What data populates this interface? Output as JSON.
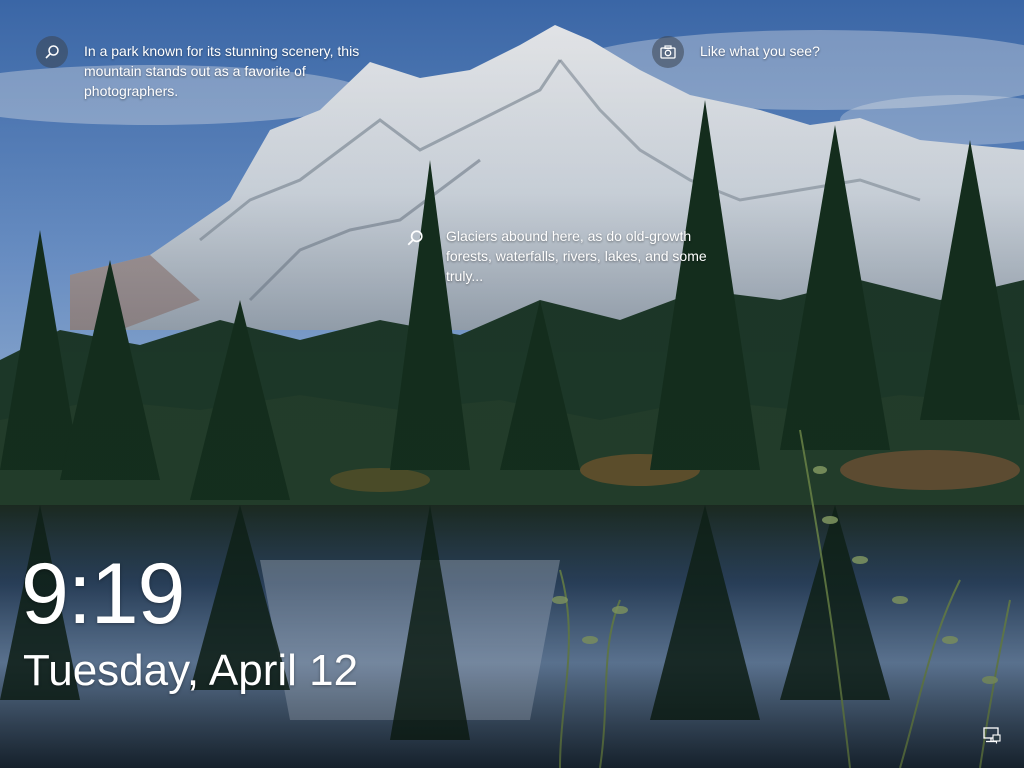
{
  "lock_screen": {
    "hotspots": {
      "park": {
        "icon": "search-icon",
        "text": "In a park known for its stunning scenery, this mountain stands out as a favorite of photographers."
      },
      "like": {
        "icon": "camera-icon",
        "text": "Like what you see?"
      },
      "glacier": {
        "icon": "search-icon",
        "text": "Glaciers abound here, as do old-growth forests, waterfalls, rivers, lakes, and some truly..."
      }
    },
    "clock": {
      "time": "9:19",
      "date": "Tuesday, April 12"
    },
    "status": {
      "network_icon": "network-icon"
    }
  },
  "colors": {
    "text": "#ffffff",
    "icon_circle": "#3c4650",
    "sky": "#5a86c4",
    "snow": "#e8edf3",
    "forest": "#1d3b2a",
    "lake": "#23364a"
  }
}
